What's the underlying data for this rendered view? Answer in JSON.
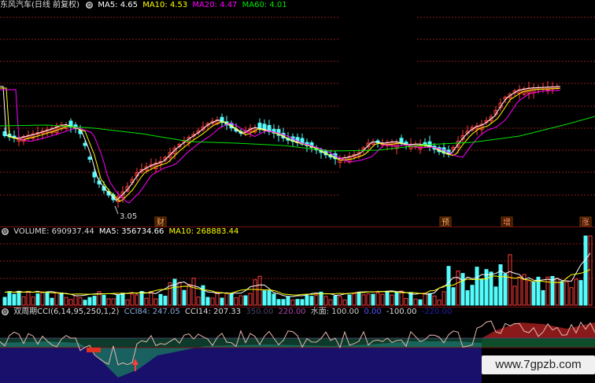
{
  "price_legend": {
    "stock": "东风汽车(日线 前复权)",
    "ma5": "MA5: 4.65",
    "ma10": "MA10: 4.53",
    "ma20": "MA20: 4.47",
    "ma60": "MA60: 4.01"
  },
  "price_annotations": {
    "low_label": "3.05",
    "markers": [
      "财",
      "预",
      "增",
      "涨"
    ]
  },
  "volume_legend": {
    "volume": "VOLUME: 690937.44",
    "ma5": "MA5: 356734.66",
    "ma10": "MA10: 268883.44"
  },
  "cci_legend": {
    "name": "双周期CCI(6,14,95,250,1,2)",
    "cci84": "CCI84: 247.05",
    "cci14": "CCI14: 207.33",
    "v1": "350.00",
    "v2": "220.00",
    "water": "水面: 100.00",
    "zero": "0.00",
    "neg": "-100.00",
    "v3": "-220.00"
  },
  "watermark": "www.7gpzb.com",
  "colors": {
    "up": "#ff3c3c",
    "down": "#54fcfc",
    "ma5": "#ffffff",
    "ma10": "#ffff00",
    "ma20": "#ff00ff",
    "ma60": "#00e600",
    "grid": "#8b1a1a"
  },
  "chart_data": [
    {
      "type": "candlestick",
      "title": "东风汽车(日线 前复权)",
      "series": [
        {
          "name": "MA5",
          "values": []
        },
        {
          "name": "MA10",
          "values": []
        },
        {
          "name": "MA20",
          "values": []
        },
        {
          "name": "MA60",
          "values": []
        }
      ],
      "annotations": [
        "3.05"
      ]
    },
    {
      "type": "bar",
      "title": "VOLUME",
      "series": [
        {
          "name": "MA5",
          "values": []
        },
        {
          "name": "MA10",
          "values": []
        }
      ]
    },
    {
      "type": "line",
      "title": "双周期CCI(6,14,95,250,1,2)",
      "series": [
        {
          "name": "CCI84",
          "values": []
        },
        {
          "name": "CCI14",
          "values": []
        }
      ]
    }
  ]
}
